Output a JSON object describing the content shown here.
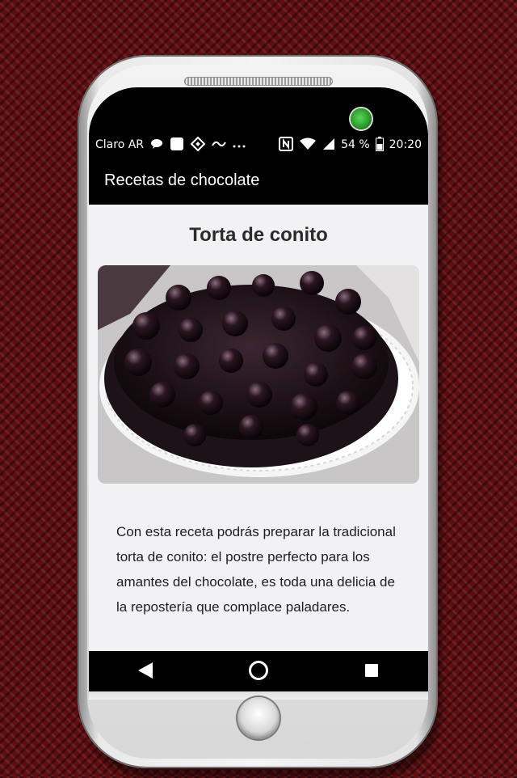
{
  "status_bar": {
    "carrier": "Claro AR",
    "battery": "54 %",
    "time": "20:20",
    "icons": [
      "chat-bubble-icon",
      "square-notification-icon",
      "binance-icon",
      "swipe-gesture-icon",
      "more-dots-icon",
      "nfc-icon",
      "wifi-icon",
      "signal-icon",
      "battery-icon"
    ]
  },
  "app_bar": {
    "title": "Recetas de chocolate"
  },
  "recipe": {
    "title": "Torta de conito",
    "description": "Con esta receta podrás preparar la tradicional torta de conito: el postre perfecto para los amantes del chocolate, es toda una delicia de la repostería que complace paladares."
  },
  "nav_bar": {
    "icons": [
      "back-triangle-icon",
      "home-circle-icon",
      "recents-square-icon"
    ]
  },
  "colors": {
    "background": "#5e0d10",
    "bar_black": "#000000",
    "content_bg": "#f2f2f5",
    "camera_led": "#2a9e2a"
  }
}
